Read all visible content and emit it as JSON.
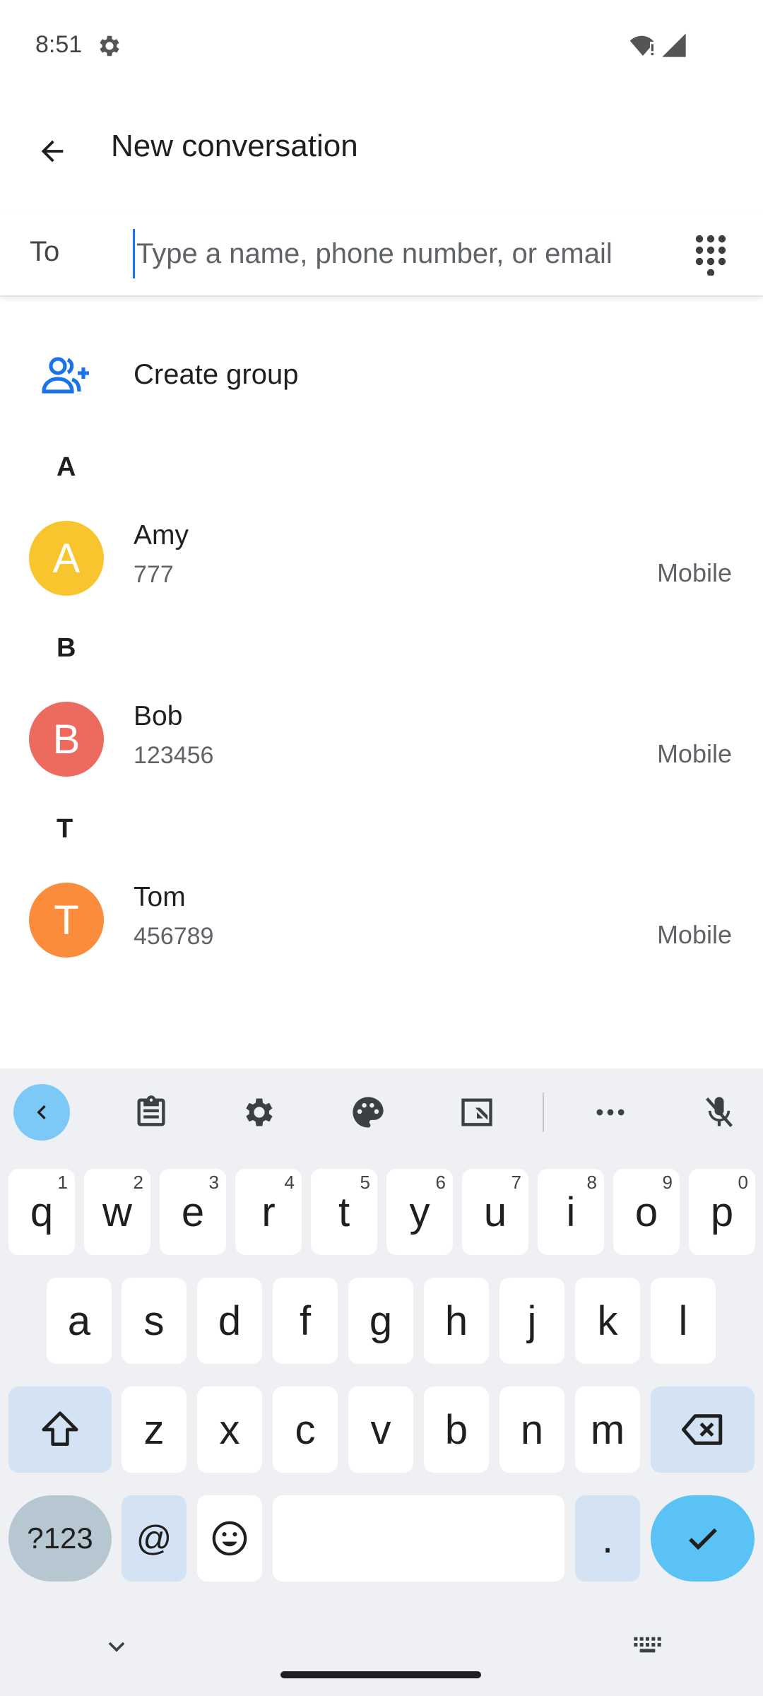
{
  "status_bar": {
    "time": "8:51"
  },
  "app_bar": {
    "title": "New conversation"
  },
  "recipient": {
    "label": "To",
    "placeholder": "Type a name, phone number, or email"
  },
  "create_group": {
    "label": "Create group"
  },
  "contact_sections": [
    {
      "letter": "A",
      "contacts": [
        {
          "initial": "A",
          "name": "Amy",
          "number": "777",
          "type": "Mobile",
          "color": "#f9c52f"
        }
      ]
    },
    {
      "letter": "B",
      "contacts": [
        {
          "initial": "B",
          "name": "Bob",
          "number": "123456",
          "type": "Mobile",
          "color": "#ec6a5e"
        }
      ]
    },
    {
      "letter": "T",
      "contacts": [
        {
          "initial": "T",
          "name": "Tom",
          "number": "456789",
          "type": "Mobile",
          "color": "#fb8c3b"
        }
      ]
    }
  ],
  "keyboard": {
    "toolbar_icons": [
      "chevron-left-icon",
      "clipboard-icon",
      "gear-icon",
      "palette-icon",
      "resize-icon",
      "more-icon",
      "mic-off-icon"
    ],
    "row1": [
      {
        "key": "q",
        "hint": "1"
      },
      {
        "key": "w",
        "hint": "2"
      },
      {
        "key": "e",
        "hint": "3"
      },
      {
        "key": "r",
        "hint": "4"
      },
      {
        "key": "t",
        "hint": "5"
      },
      {
        "key": "y",
        "hint": "6"
      },
      {
        "key": "u",
        "hint": "7"
      },
      {
        "key": "i",
        "hint": "8"
      },
      {
        "key": "o",
        "hint": "9"
      },
      {
        "key": "p",
        "hint": "0"
      }
    ],
    "row2": [
      "a",
      "s",
      "d",
      "f",
      "g",
      "h",
      "j",
      "k",
      "l"
    ],
    "row3": [
      "z",
      "x",
      "c",
      "v",
      "b",
      "n",
      "m"
    ],
    "symbols_label": "?123",
    "at_label": "@",
    "period_label": "."
  },
  "colors": {
    "accent": "#1a73e8",
    "keyboard_bg": "#eef0f4",
    "enter_key": "#5ac2f5",
    "modifier_key": "#d3e3f3"
  }
}
